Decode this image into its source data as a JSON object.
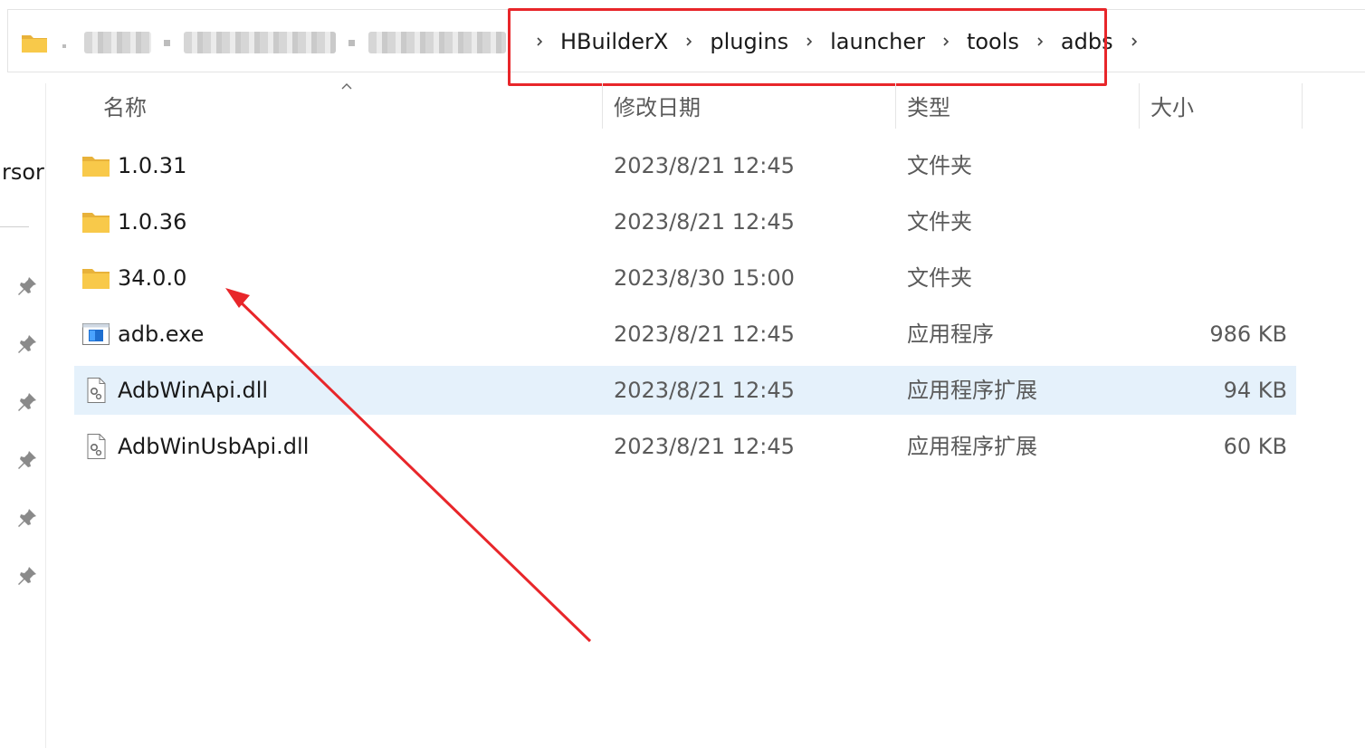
{
  "breadcrumb": {
    "items": [
      "HBuilderX",
      "plugins",
      "launcher",
      "tools",
      "adbs"
    ]
  },
  "nav": {
    "partial_label": "rsor"
  },
  "columns": {
    "name": "名称",
    "modified": "修改日期",
    "type": "类型",
    "size": "大小"
  },
  "files": [
    {
      "name": "1.0.31",
      "modified": "2023/8/21 12:45",
      "type": "文件夹",
      "size": "",
      "icon": "folder-icon"
    },
    {
      "name": "1.0.36",
      "modified": "2023/8/21 12:45",
      "type": "文件夹",
      "size": "",
      "icon": "folder-icon"
    },
    {
      "name": "34.0.0",
      "modified": "2023/8/30 15:00",
      "type": "文件夹",
      "size": "",
      "icon": "folder-icon"
    },
    {
      "name": "adb.exe",
      "modified": "2023/8/21 12:45",
      "type": "应用程序",
      "size": "986 KB",
      "icon": "application-icon"
    },
    {
      "name": "AdbWinApi.dll",
      "modified": "2023/8/21 12:45",
      "type": "应用程序扩展",
      "size": "94 KB",
      "icon": "dll-file-icon",
      "selected": true
    },
    {
      "name": "AdbWinUsbApi.dll",
      "modified": "2023/8/21 12:45",
      "type": "应用程序扩展",
      "size": "60 KB",
      "icon": "dll-file-icon"
    }
  ],
  "colors": {
    "highlight_annotation": "#e8262a",
    "selected_row": "#e5f1fb",
    "folder": "#f8c94a"
  },
  "icons": {
    "address_folder": "folder-icon",
    "breadcrumb_separator": "chevron-right-icon",
    "sort_indicator": "chevron-up-icon",
    "quick_access_pin": "pin-icon",
    "annotation_arrow": "red-arrow-annotation"
  }
}
